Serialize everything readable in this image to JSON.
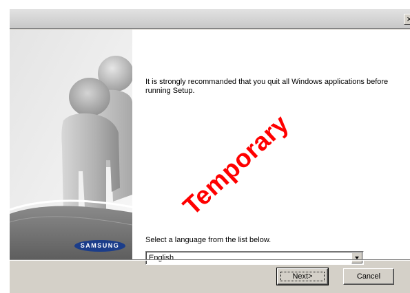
{
  "window": {
    "close_glyph": "×"
  },
  "side_panel": {
    "logo_text": "SAMSUNG",
    "illustration": "people-silhouette-icon"
  },
  "main": {
    "message": "It is strongly recommanded that you quit all Windows applications before running Setup.",
    "watermark": "Temporary",
    "language_label": "Select a language from the list below.",
    "language_select": {
      "selected": "English"
    }
  },
  "buttons": {
    "next_label": "Next>",
    "cancel_label": "Cancel"
  },
  "colors": {
    "dialog_face": "#d4d0c8",
    "watermark": "#ff0000",
    "logo_bg": "#1b3d8a",
    "swoosh": "#7a7a7a"
  }
}
